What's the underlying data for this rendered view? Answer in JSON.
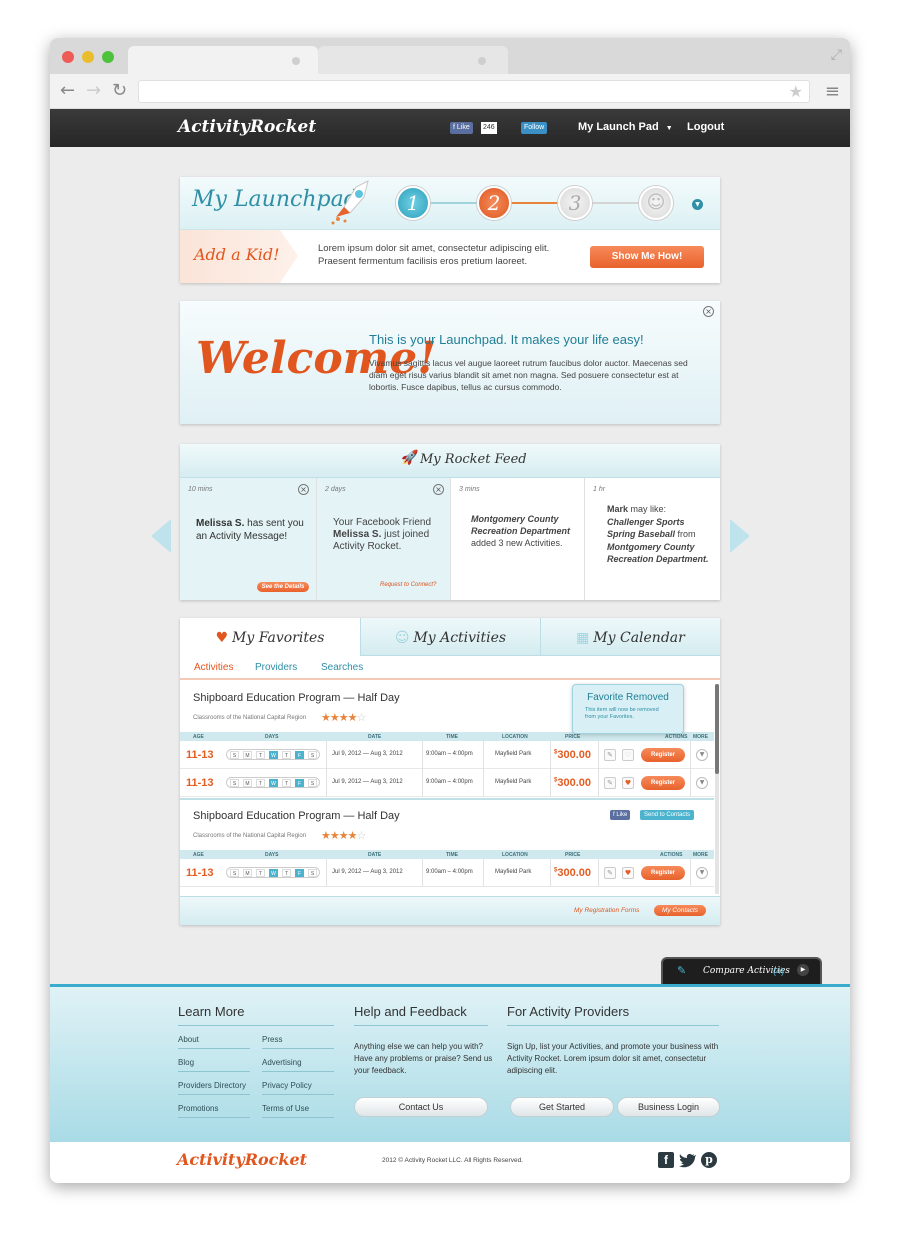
{
  "nav": {
    "logo_a": "Activity",
    "logo_b": "Rocket",
    "fb_like": "Like",
    "fb_count": "246",
    "tw_follow": "Follow",
    "launchpad_menu": "My Launch Pad",
    "logout": "Logout"
  },
  "launchpad": {
    "title": "My Launchpad",
    "steps": [
      "1",
      "2",
      "3"
    ],
    "add_kid": "Add a Kid!",
    "text": "Lorem ipsum dolor sit amet, consectetur adipiscing elit. Praesent fermentum facilisis eros pretium laoreet.",
    "button": "Show Me How!"
  },
  "welcome": {
    "heading": "Welcome!",
    "title": "This is your Launchpad. It makes your life easy!",
    "body": "Vivamus sagittis lacus vel augue laoreet rutrum faucibus dolor auctor. Maecenas sed diam eget risus varius blandit sit amet non magna. Sed posuere consectetur est at lobortis. Fusce dapibus, tellus ac cursus commodo."
  },
  "feed": {
    "title": "My Rocket Feed",
    "items": [
      {
        "time": "10 mins",
        "bold": "Melissa S.",
        "text": " has sent you an Activity Message!",
        "action": "See the Details"
      },
      {
        "time": "2 days",
        "pre": "Your Facebook Friend ",
        "bold": "Melissa S.",
        "text": " just joined Activity Rocket.",
        "action": "Request to Connect?"
      },
      {
        "time": "3 mins",
        "bold": "Montgomery County Recreation Department",
        "text": " added 3 new Activities."
      },
      {
        "time": "1 hr",
        "bold": "Mark",
        "text": " may like: ",
        "bold2": "Challenger Sports Spring Baseball",
        "text2": " from ",
        "bold3": "Montgomery County Recreation Department."
      }
    ]
  },
  "tabs": {
    "favorites": "My Favorites",
    "activities": "My Activities",
    "calendar": "My Calendar",
    "sub": [
      "Activities",
      "Providers",
      "Searches"
    ]
  },
  "table": {
    "headers": [
      "AGE",
      "DAYS",
      "DATE",
      "TIME",
      "LOCATION",
      "PRICE",
      "ACTIONS",
      "MORE"
    ],
    "day_letters": [
      "S",
      "M",
      "T",
      "W",
      "T",
      "F",
      "S"
    ],
    "programs": [
      {
        "title": "Shipboard Education Program — Half Day",
        "sub": "Classrooms of the National Capital Region",
        "rows": [
          {
            "age": "11-13",
            "date": "Jul 9, 2012 — Aug 3, 2012",
            "time": "9:00am – 4:00pm",
            "location": "Mayfield Park",
            "price_sym": "$",
            "price": "300.00",
            "register": "Register"
          },
          {
            "age": "11-13",
            "date": "Jul 9, 2012 — Aug 3, 2012",
            "time": "9:00am – 4:00pm",
            "location": "Mayfield Park",
            "price_sym": "$",
            "price": "300.00",
            "register": "Register"
          }
        ]
      },
      {
        "title": "Shipboard Education Program — Half Day",
        "sub": "Classrooms of the National Capital Region",
        "like": "Like",
        "send": "Send to Contacts",
        "rows": [
          {
            "age": "11-13",
            "date": "Jul 9, 2012 — Aug 3, 2012",
            "time": "9:00am – 4:00pm",
            "location": "Mayfield Park",
            "price_sym": "$",
            "price": "300.00",
            "register": "Register"
          }
        ]
      }
    ],
    "tooltip_title": "Favorite Removed",
    "tooltip_body": "This item will now be removed from your Favorites.",
    "reg_forms": "My Registration Forms",
    "my_contacts": "My Contacts"
  },
  "compare": {
    "label": "Compare Activities",
    "count": "(4)"
  },
  "footer": {
    "learn_more": "Learn More",
    "links_left": [
      "About",
      "Blog",
      "Providers Directory",
      "Promotions"
    ],
    "links_right": [
      "Press",
      "Advertising",
      "Privacy Policy",
      "Terms of Use"
    ],
    "help_title": "Help and Feedback",
    "help_text": "Anything else we can help you with? Have any problems or praise? Send us your feedback.",
    "contact": "Contact Us",
    "providers_title": "For Activity Providers",
    "providers_text": "Sign Up, list your Activities, and promote your business with Activity Rocket. Lorem ipsum dolor sit amet, consectetur adipiscing elit.",
    "get_started": "Get Started",
    "business_login": "Business Login",
    "copyright": "2012 © Activity Rocket LLC. All Rights Reserved."
  },
  "colors": {
    "accent": "#e8622c",
    "teal": "#3aaccd",
    "dark_nav": "#2b2b2b"
  }
}
